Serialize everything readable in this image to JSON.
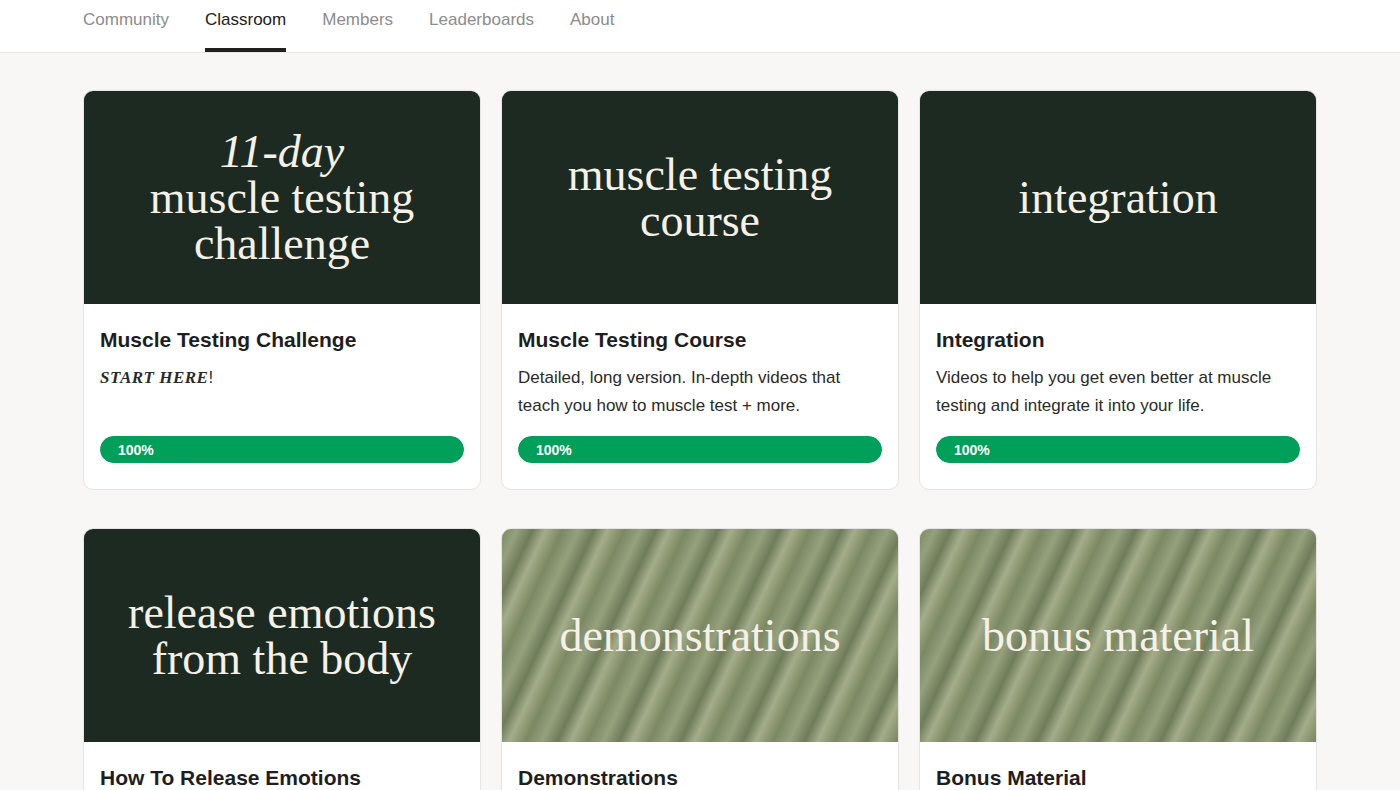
{
  "nav": {
    "tabs": [
      {
        "label": "Community",
        "selected": false
      },
      {
        "label": "Classroom",
        "selected": true
      },
      {
        "label": "Members",
        "selected": false
      },
      {
        "label": "Leaderboards",
        "selected": false
      },
      {
        "label": "About",
        "selected": false
      }
    ]
  },
  "courses": [
    {
      "kind": "dark",
      "cover_lines": [
        {
          "text": "11-day",
          "italic": true
        },
        {
          "text": "muscle testing",
          "italic": false
        },
        {
          "text": "challenge",
          "italic": false
        }
      ],
      "title": "Muscle Testing Challenge",
      "description": [
        {
          "text": "START HERE",
          "emphasis": true
        },
        {
          "text": "!",
          "emphasis": false
        }
      ],
      "progress": {
        "level": 1,
        "label": "100%"
      }
    },
    {
      "kind": "dark",
      "cover_lines": [
        {
          "text": "muscle testing",
          "italic": false
        },
        {
          "text": "course",
          "italic": false
        }
      ],
      "title": "Muscle Testing Course",
      "description": [
        {
          "text": "Detailed, long version. In-depth videos that teach you how to muscle test + more.",
          "emphasis": false
        }
      ],
      "progress": {
        "level": 1,
        "label": "100%"
      }
    },
    {
      "kind": "dark",
      "cover_lines": [
        {
          "text": "integration",
          "italic": false
        }
      ],
      "title": "Integration",
      "description": [
        {
          "text": "Videos to help you get even better at muscle testing and integrate it into your life.",
          "emphasis": false
        }
      ],
      "progress": {
        "level": 1,
        "label": "100%"
      }
    },
    {
      "kind": "dark",
      "cover_lines": [
        {
          "text": "release emotions",
          "italic": false
        },
        {
          "text": "from the body",
          "italic": false
        }
      ],
      "title": "How To Release Emotions",
      "description": [],
      "progress": null
    },
    {
      "kind": "photo",
      "cover_lines": [
        {
          "text": "demonstrations",
          "italic": false
        }
      ],
      "title": "Demonstrations",
      "description": [],
      "progress": null
    },
    {
      "kind": "photo",
      "cover_lines": [
        {
          "text": "bonus material",
          "italic": false
        }
      ],
      "title": "Bonus Material",
      "description": [],
      "progress": null
    }
  ]
}
